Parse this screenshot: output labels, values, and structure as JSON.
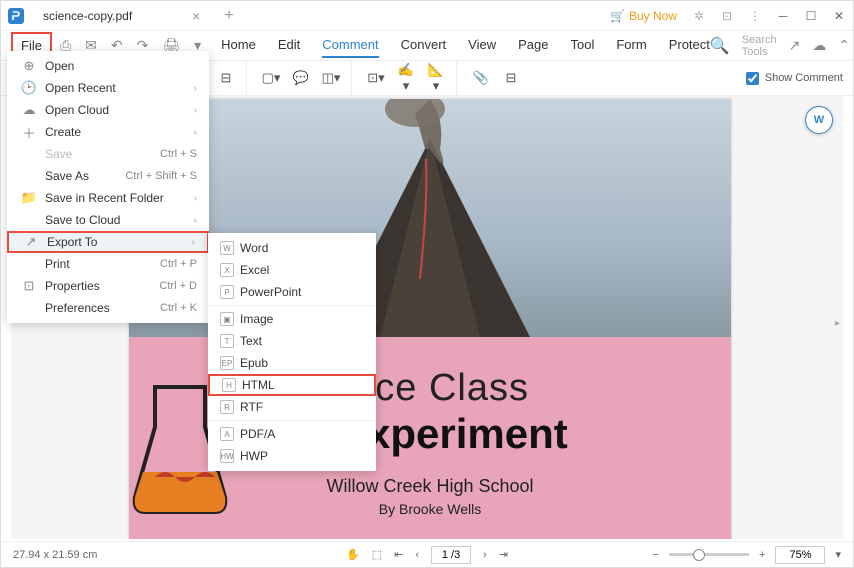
{
  "tab": {
    "title": "science-copy.pdf"
  },
  "buy_now": "Buy Now",
  "menu": {
    "file": "File",
    "items": [
      "Home",
      "Edit",
      "Comment",
      "Convert",
      "View",
      "Page",
      "Tool",
      "Form",
      "Protect"
    ],
    "active_index": 2,
    "search_placeholder": "Search Tools"
  },
  "toolbar": {
    "show_comment": "Show Comment"
  },
  "file_menu": [
    {
      "icon": "⊕",
      "label": "Open",
      "shortcut": "",
      "arrow": false,
      "disabled": false
    },
    {
      "icon": "🕑",
      "label": "Open Recent",
      "shortcut": "",
      "arrow": true,
      "disabled": false
    },
    {
      "icon": "☁",
      "label": "Open Cloud",
      "shortcut": "",
      "arrow": true,
      "disabled": false
    },
    {
      "icon": "＋",
      "label": "Create",
      "shortcut": "",
      "arrow": true,
      "disabled": false
    },
    {
      "icon": "",
      "label": "Save",
      "shortcut": "Ctrl + S",
      "arrow": false,
      "disabled": true
    },
    {
      "icon": "",
      "label": "Save As",
      "shortcut": "Ctrl + Shift + S",
      "arrow": false,
      "disabled": false
    },
    {
      "icon": "📁",
      "label": "Save in Recent Folder",
      "shortcut": "",
      "arrow": true,
      "disabled": false
    },
    {
      "icon": "",
      "label": "Save to Cloud",
      "shortcut": "",
      "arrow": true,
      "disabled": false
    },
    {
      "icon": "↗",
      "label": "Export To",
      "shortcut": "",
      "arrow": true,
      "disabled": false,
      "highlight": true
    },
    {
      "icon": "",
      "label": "Print",
      "shortcut": "Ctrl + P",
      "arrow": false,
      "disabled": false
    },
    {
      "icon": "⊡",
      "label": "Properties",
      "shortcut": "Ctrl + D",
      "arrow": false,
      "disabled": false
    },
    {
      "icon": "",
      "label": "Preferences",
      "shortcut": "Ctrl + K",
      "arrow": false,
      "disabled": false
    }
  ],
  "export_menu": [
    {
      "icon": "W",
      "label": "Word"
    },
    {
      "icon": "X",
      "label": "Excel"
    },
    {
      "icon": "P",
      "label": "PowerPoint"
    },
    {
      "icon": "▣",
      "label": "Image"
    },
    {
      "icon": "T",
      "label": "Text"
    },
    {
      "icon": "EP",
      "label": "Epub"
    },
    {
      "icon": "H",
      "label": "HTML",
      "highlight": true
    },
    {
      "icon": "R",
      "label": "RTF"
    },
    {
      "icon": "A",
      "label": "PDF/A"
    },
    {
      "icon": "HW",
      "label": "HWP"
    }
  ],
  "document": {
    "title1": "ence Class",
    "title2": "ic Experiment",
    "school": "Willow Creek High School",
    "author": "By Brooke Wells"
  },
  "statusbar": {
    "dimensions": "27.94 x 21.59 cm",
    "page": "1 /3",
    "zoom": "75%"
  }
}
